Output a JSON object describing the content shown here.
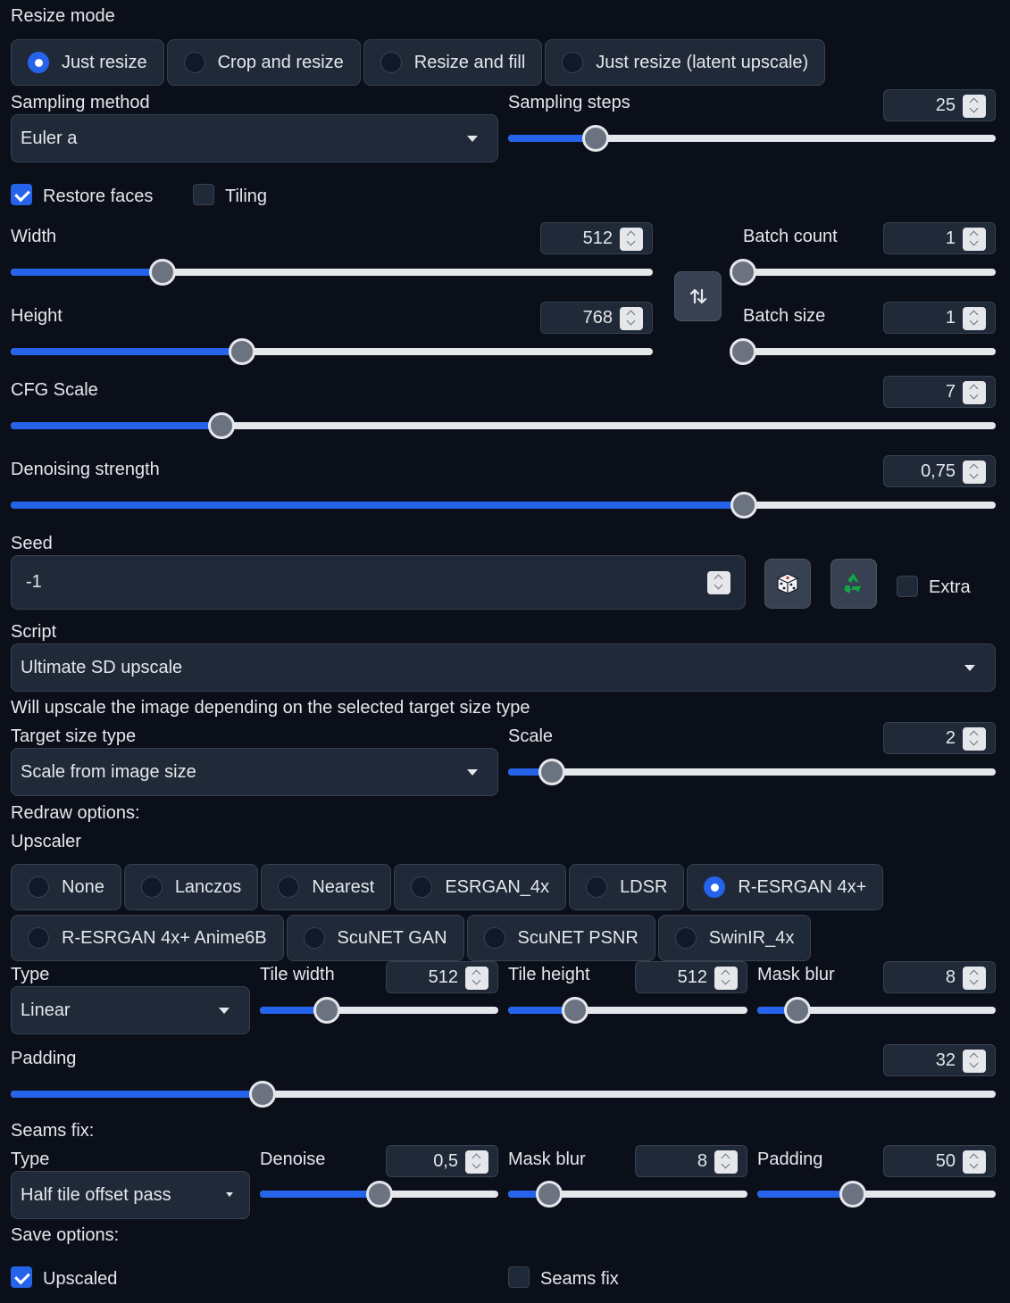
{
  "resize_mode": {
    "label": "Resize mode",
    "options": [
      "Just resize",
      "Crop and resize",
      "Resize and fill",
      "Just resize (latent upscale)"
    ],
    "selected": 0
  },
  "sampling_method": {
    "label": "Sampling method",
    "value": "Euler a"
  },
  "sampling_steps": {
    "label": "Sampling steps",
    "value": "25",
    "fraction": 0.18
  },
  "restore_faces": {
    "label": "Restore faces",
    "checked": true
  },
  "tiling": {
    "label": "Tiling",
    "checked": false
  },
  "width": {
    "label": "Width",
    "value": "512",
    "fraction": 0.237
  },
  "height": {
    "label": "Height",
    "value": "768",
    "fraction": 0.36
  },
  "batch_count": {
    "label": "Batch count",
    "value": "1",
    "fraction": 0.0
  },
  "batch_size": {
    "label": "Batch size",
    "value": "1",
    "fraction": 0.0
  },
  "swap_icon": "swap-vertical-icon",
  "cfg_scale": {
    "label": "CFG Scale",
    "value": "7",
    "fraction": 0.214
  },
  "denoising_strength": {
    "label": "Denoising strength",
    "value": "0,75",
    "fraction": 0.744
  },
  "seed": {
    "label": "Seed",
    "value": "-1",
    "extra_label": "Extra",
    "extra_checked": false
  },
  "seed_icons": {
    "random": "dice-icon",
    "reuse": "recycle-icon"
  },
  "script": {
    "label": "Script",
    "value": "Ultimate SD upscale"
  },
  "script_info": "Will upscale the image depending on the selected target size type",
  "target_size_type": {
    "label": "Target size type",
    "value": "Scale from image size"
  },
  "scale": {
    "label": "Scale",
    "value": "2",
    "fraction": 0.09
  },
  "redraw_options_label": "Redraw options:",
  "upscaler": {
    "label": "Upscaler",
    "row1": [
      "None",
      "Lanczos",
      "Nearest",
      "ESRGAN_4x",
      "LDSR",
      "R-ESRGAN 4x+"
    ],
    "row2": [
      "R-ESRGAN 4x+ Anime6B",
      "ScuNET GAN",
      "ScuNET PSNR",
      "SwinIR_4x"
    ],
    "selected": "R-ESRGAN 4x+"
  },
  "redraw_type": {
    "label": "Type",
    "value": "Linear"
  },
  "tile_width": {
    "label": "Tile width",
    "value": "512",
    "fraction": 0.28
  },
  "tile_height": {
    "label": "Tile height",
    "value": "512",
    "fraction": 0.28
  },
  "mask_blur": {
    "label": "Mask blur",
    "value": "8",
    "fraction": 0.17
  },
  "padding": {
    "label": "Padding",
    "value": "32",
    "fraction": 0.256
  },
  "seams_fix_label": "Seams fix:",
  "seams_type": {
    "label": "Type",
    "value": "Half tile offset pass"
  },
  "seams_denoise": {
    "label": "Denoise",
    "value": "0,5",
    "fraction": 0.5
  },
  "seams_mask_blur": {
    "label": "Mask blur",
    "value": "8",
    "fraction": 0.17
  },
  "seams_padding": {
    "label": "Padding",
    "value": "50",
    "fraction": 0.4
  },
  "save_options_label": "Save options:",
  "save_upscaled": {
    "label": "Upscaled",
    "checked": true
  },
  "save_seams_fix": {
    "label": "Seams fix",
    "checked": false
  },
  "colors": {
    "accent": "#2563eb",
    "background": "#0b0f19",
    "panel": "#1f2937",
    "border": "#374151"
  }
}
